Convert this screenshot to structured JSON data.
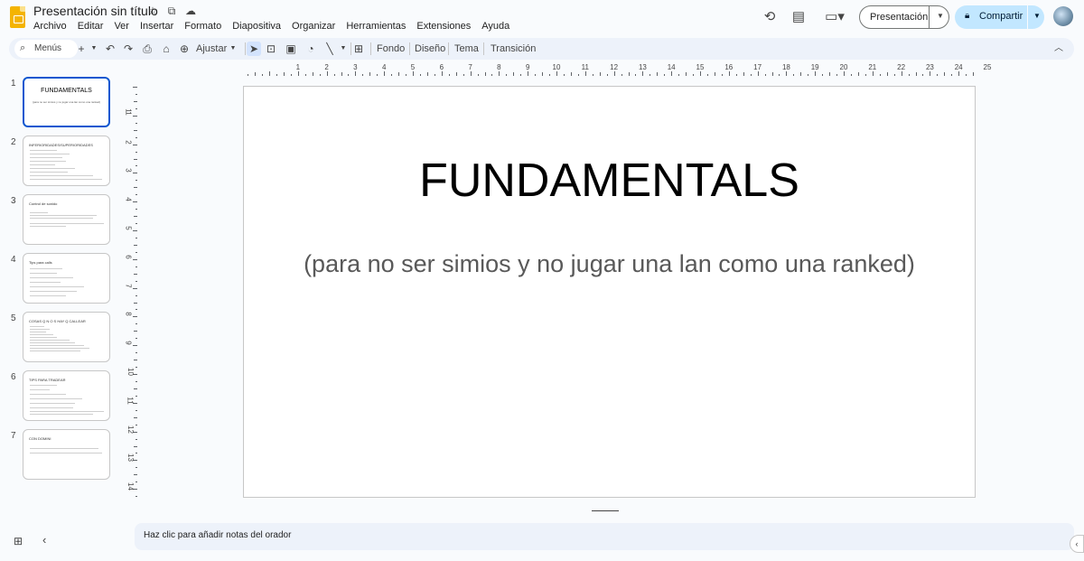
{
  "header": {
    "doc_title": "Presentación sin título",
    "menu": [
      "Archivo",
      "Editar",
      "Ver",
      "Insertar",
      "Formato",
      "Diapositiva",
      "Organizar",
      "Herramientas",
      "Extensiones",
      "Ayuda"
    ],
    "present_label": "Presentación",
    "share_label": "Compartir"
  },
  "toolbar": {
    "menus_label": "Menús",
    "zoom_label": "Ajustar",
    "fondo": "Fondo",
    "diseno": "Diseño",
    "tema": "Tema",
    "transicion": "Transición"
  },
  "ruler_top": [
    "1",
    "1",
    "2",
    "3",
    "4",
    "5",
    "6",
    "7",
    "8",
    "9",
    "10",
    "11",
    "12",
    "13",
    "14",
    "15",
    "16",
    "17",
    "18",
    "19",
    "20",
    "21",
    "22",
    "23",
    "24",
    "25"
  ],
  "ruler_left": [
    "1",
    "1",
    "2",
    "3",
    "4",
    "5",
    "6",
    "7",
    "8",
    "9",
    "10",
    "11",
    "12",
    "13",
    "14"
  ],
  "slides": [
    {
      "num": "1",
      "title": "FUNDAMENTALS",
      "subtitle": "(para no ser simios y no jugar una lan como una ranked)"
    },
    {
      "num": "2",
      "heading": "INFERIORIDADES/SUPERIORIDADES"
    },
    {
      "num": "3",
      "heading": "Control de sonido"
    },
    {
      "num": "4",
      "heading": "Tips para calls"
    },
    {
      "num": "5",
      "heading": "COSAS Q N O S HAY Q CALLEAR"
    },
    {
      "num": "6",
      "heading": "TIPS PARA TRADEAR"
    },
    {
      "num": "7",
      "heading": "CON DOMINI"
    }
  ],
  "canvas": {
    "title": "FUNDAMENTALS",
    "subtitle": "(para no ser simios y no jugar una lan como una ranked)"
  },
  "notes": {
    "placeholder": "Haz clic para añadir notas del orador"
  }
}
